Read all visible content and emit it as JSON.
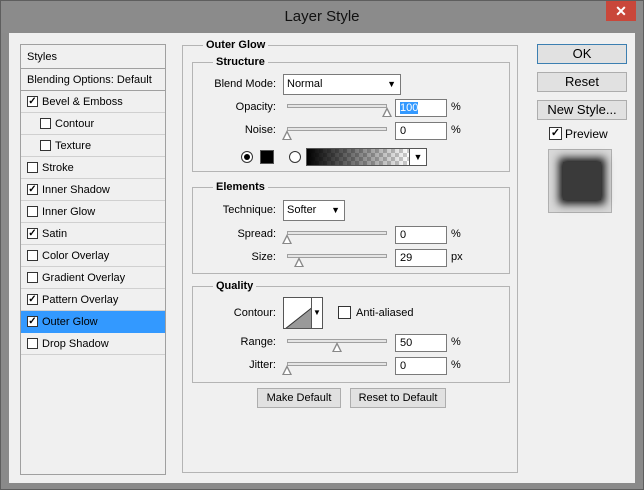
{
  "window": {
    "title": "Layer Style",
    "close_label": "✕"
  },
  "sidebar": {
    "header": "Styles",
    "blending": "Blending Options: Default",
    "items": [
      {
        "label": "Bevel & Emboss",
        "checked": true,
        "indent": false,
        "selected": false
      },
      {
        "label": "Contour",
        "checked": false,
        "indent": true,
        "selected": false
      },
      {
        "label": "Texture",
        "checked": false,
        "indent": true,
        "selected": false
      },
      {
        "label": "Stroke",
        "checked": false,
        "indent": false,
        "selected": false
      },
      {
        "label": "Inner Shadow",
        "checked": true,
        "indent": false,
        "selected": false
      },
      {
        "label": "Inner Glow",
        "checked": false,
        "indent": false,
        "selected": false
      },
      {
        "label": "Satin",
        "checked": true,
        "indent": false,
        "selected": false
      },
      {
        "label": "Color Overlay",
        "checked": false,
        "indent": false,
        "selected": false
      },
      {
        "label": "Gradient Overlay",
        "checked": false,
        "indent": false,
        "selected": false
      },
      {
        "label": "Pattern Overlay",
        "checked": true,
        "indent": false,
        "selected": false
      },
      {
        "label": "Outer Glow",
        "checked": true,
        "indent": false,
        "selected": true
      },
      {
        "label": "Drop Shadow",
        "checked": false,
        "indent": false,
        "selected": false
      }
    ]
  },
  "panel": {
    "title": "Outer Glow",
    "structure": {
      "title": "Structure",
      "blend_mode_label": "Blend Mode:",
      "blend_mode_value": "Normal",
      "opacity_label": "Opacity:",
      "opacity_value": "100",
      "opacity_unit": "%",
      "noise_label": "Noise:",
      "noise_value": "0",
      "noise_unit": "%",
      "color_choice": "solid",
      "glow_color": "#000000"
    },
    "elements": {
      "title": "Elements",
      "technique_label": "Technique:",
      "technique_value": "Softer",
      "spread_label": "Spread:",
      "spread_value": "0",
      "spread_unit": "%",
      "size_label": "Size:",
      "size_value": "29",
      "size_unit": "px"
    },
    "quality": {
      "title": "Quality",
      "contour_label": "Contour:",
      "anti_aliased_label": "Anti-aliased",
      "anti_aliased": false,
      "range_label": "Range:",
      "range_value": "50",
      "range_unit": "%",
      "jitter_label": "Jitter:",
      "jitter_value": "0",
      "jitter_unit": "%"
    },
    "make_default": "Make Default",
    "reset_default": "Reset to Default"
  },
  "actions": {
    "ok": "OK",
    "reset": "Reset",
    "new_style": "New Style...",
    "preview_label": "Preview",
    "preview_checked": true
  },
  "sliders": {
    "opacity": 1.0,
    "noise": 0.0,
    "spread": 0.0,
    "size": 0.12,
    "range": 0.5,
    "jitter": 0.0
  },
  "colors": {
    "selection": "#3399ff",
    "dialog_bg": "#f0f0f0"
  }
}
